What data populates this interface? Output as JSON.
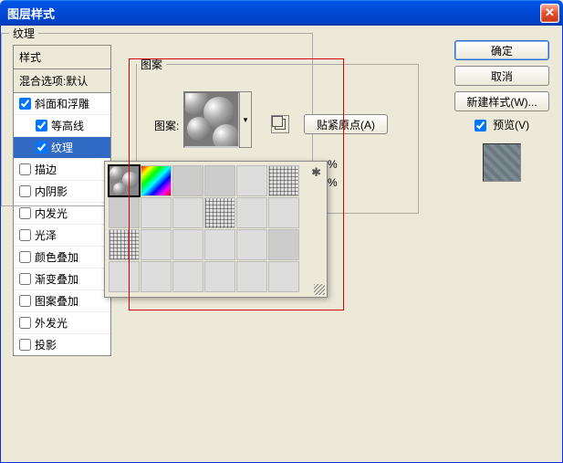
{
  "dialog": {
    "title": "图层样式"
  },
  "styles_panel": {
    "header": "样式",
    "blending": "混合选项:默认",
    "items": [
      {
        "label": "斜面和浮雕",
        "checked": true,
        "selected": false,
        "indent": false
      },
      {
        "label": "等高线",
        "checked": true,
        "selected": false,
        "indent": true
      },
      {
        "label": "纹理",
        "checked": true,
        "selected": true,
        "indent": true
      },
      {
        "label": "描边",
        "checked": false,
        "selected": false,
        "indent": false
      },
      {
        "label": "内阴影",
        "checked": false,
        "selected": false,
        "indent": false
      },
      {
        "label": "内发光",
        "checked": false,
        "selected": false,
        "indent": false
      },
      {
        "label": "光泽",
        "checked": false,
        "selected": false,
        "indent": false
      },
      {
        "label": "颜色叠加",
        "checked": false,
        "selected": false,
        "indent": false
      },
      {
        "label": "渐变叠加",
        "checked": false,
        "selected": false,
        "indent": false
      },
      {
        "label": "图案叠加",
        "checked": false,
        "selected": false,
        "indent": false
      },
      {
        "label": "外发光",
        "checked": false,
        "selected": false,
        "indent": false
      },
      {
        "label": "投影",
        "checked": false,
        "selected": false,
        "indent": false
      }
    ]
  },
  "texture": {
    "group_label": "纹理",
    "pattern_group_label": "图案",
    "pattern_label": "图案:",
    "snap_origin_label": "贴紧原点(A)",
    "percent": "%"
  },
  "buttons": {
    "ok": "确定",
    "cancel": "取消",
    "new_style": "新建样式(W)..."
  },
  "preview": {
    "label": "预览(V)",
    "checked": true
  },
  "picker": {
    "selected_index": 0,
    "count": 24
  }
}
